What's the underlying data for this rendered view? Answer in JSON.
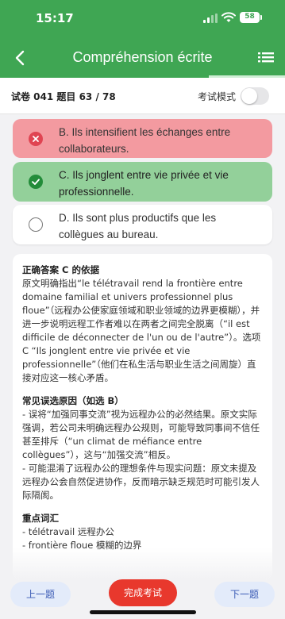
{
  "status": {
    "time": "15:17",
    "battery": "58"
  },
  "header": {
    "title": "Compréhension écrite"
  },
  "exam": {
    "info": "试卷 041  题目 63 / 78",
    "mode_label": "考试模式",
    "mode_on": false
  },
  "options": [
    {
      "text": "B. Ils intensifient les échanges entre collaborateurs.",
      "state": "wrong"
    },
    {
      "text": "C. Ils jonglent entre vie privée et vie professionnelle.",
      "state": "correct"
    },
    {
      "text": "D. Ils sont plus productifs que les collègues au bureau.",
      "state": "neutral"
    }
  ],
  "explanation": {
    "answer_title": "正确答案 C 的依据",
    "answer_body": "原文明确指出“le télétravail rend la frontière entre domaine familial et univers professionnel plus floue”（远程办公使家庭领域和职业领域的边界更模糊），并进一步说明远程工作者难以在两者之间完全脱离（“il est difficile de déconnecter de l'un ou de l'autre”）。选项 C “Ils jonglent entre vie privée et vie professionnelle”（他们在私生活与职业生活之间周旋）直接对应这一核心矛盾。",
    "wrong_title": "常见误选原因（如选 B）",
    "wrong_line1": "- 误将“加强同事交流”视为远程办公的必然结果。原文实际强调，若公司未明确远程办公规则，可能导致同事间不信任甚至排斥（“un climat de méfiance entre collègues”），这与“加强交流”相反。",
    "wrong_line2": "- 可能混淆了远程办公的理想条件与现实问题：原文未提及远程办公会自然促进协作，反而暗示缺乏规范时可能引发人际隔阂。",
    "vocab_title": "重点词汇",
    "vocab_1": "- télétravail 远程办公",
    "vocab_2": "- frontière floue 模糊的边界"
  },
  "bottom": {
    "prev": "上一题",
    "finish": "完成考试",
    "next": "下一题"
  },
  "colors": {
    "brand_green": "#3fa653",
    "wrong": "#f39aa0",
    "correct": "#93d09a",
    "finish": "#e8382d"
  }
}
